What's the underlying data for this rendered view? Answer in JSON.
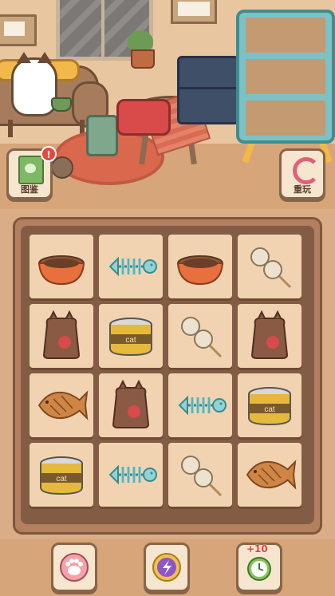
{
  "side_buttons": {
    "collection": {
      "label": "图鉴",
      "badge": "!"
    },
    "replay": {
      "label": "重玩"
    }
  },
  "board": {
    "rows": [
      [
        "pet-bowl",
        "fish-bone",
        "pet-bowl",
        "dango-skewer"
      ],
      [
        "treat-bag",
        "cat-food-can",
        "dango-skewer",
        "treat-bag"
      ],
      [
        "taiyaki-fish",
        "treat-bag",
        "fish-bone",
        "cat-food-can"
      ],
      [
        "cat-food-can",
        "fish-bone",
        "dango-skewer",
        "taiyaki-fish"
      ]
    ]
  },
  "tools": {
    "paw_icon": "paw-icon",
    "shuffle_icon": "shuffle-icon",
    "time_icon": "alarm-clock-icon",
    "time_bonus": "+10"
  },
  "colors": {
    "badge": "#e4493d",
    "board_frame": "#825c44",
    "tile": "#f2d3b1"
  }
}
